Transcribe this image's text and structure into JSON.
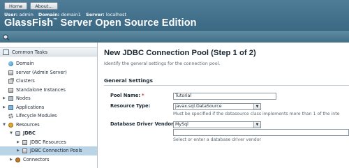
{
  "header": {
    "buttons": [
      "Home",
      "About..."
    ],
    "user_label": "User:",
    "user_value": "admin",
    "domain_label": "Domain:",
    "domain_value": "domain1",
    "server_label": "Server:",
    "server_value": "localhost",
    "product_name": "GlassFish",
    "product_tm": "™",
    "product_rest": " Server Open Source Edition",
    "tool_icon": "tool-icon"
  },
  "nav": {
    "title": "Common Tasks",
    "items": [
      {
        "label": "Domain",
        "icon": "globe-icon",
        "toggle": ""
      },
      {
        "label": "server (Admin Server)",
        "icon": "server-icon",
        "toggle": ""
      },
      {
        "label": "Clusters",
        "icon": "cluster-icon",
        "toggle": ""
      },
      {
        "label": "Standalone Instances",
        "icon": "instance-icon",
        "toggle": ""
      },
      {
        "label": "Nodes",
        "icon": "node-icon",
        "toggle": "▶"
      },
      {
        "label": "Applications",
        "icon": "application-icon",
        "toggle": "▶"
      },
      {
        "label": "Lifecycle Modules",
        "icon": "gear-icon",
        "toggle": ""
      },
      {
        "label": "Resources",
        "icon": "resources-icon",
        "toggle": "▼"
      },
      {
        "label": "JDBC",
        "icon": "database-icon",
        "toggle": "▼"
      },
      {
        "label": "JDBC Resources",
        "icon": "jdbc-resource-icon",
        "toggle": "▶"
      },
      {
        "label": "JDBC Connection Pools",
        "icon": "connection-pool-icon",
        "toggle": "▶"
      },
      {
        "label": "Connectors",
        "icon": "connector-icon",
        "toggle": "▶"
      }
    ]
  },
  "main": {
    "title": "New JDBC Connection Pool (Step 1 of 2)",
    "help": "Identify the general settings for the connection pool.",
    "section_title": "General Settings",
    "pool_name_label": "Pool Name:",
    "pool_name_required": "*",
    "pool_name_value": "Tutorial",
    "resource_type_label": "Resource Type:",
    "resource_type_value": "javax.sql.DataSource",
    "resource_type_hint": "Must be specified if the datasource class implements more than 1 of the inte",
    "driver_vendor_label": "Database Driver Vendor:",
    "driver_vendor_value": "MySql",
    "driver_vendor_text": "",
    "driver_vendor_hint": "Select or enter a database driver vendor"
  },
  "colors": {
    "masthead": "#3f6d88",
    "selected_row": "#b9d4e6",
    "required": "#c92b2b"
  }
}
